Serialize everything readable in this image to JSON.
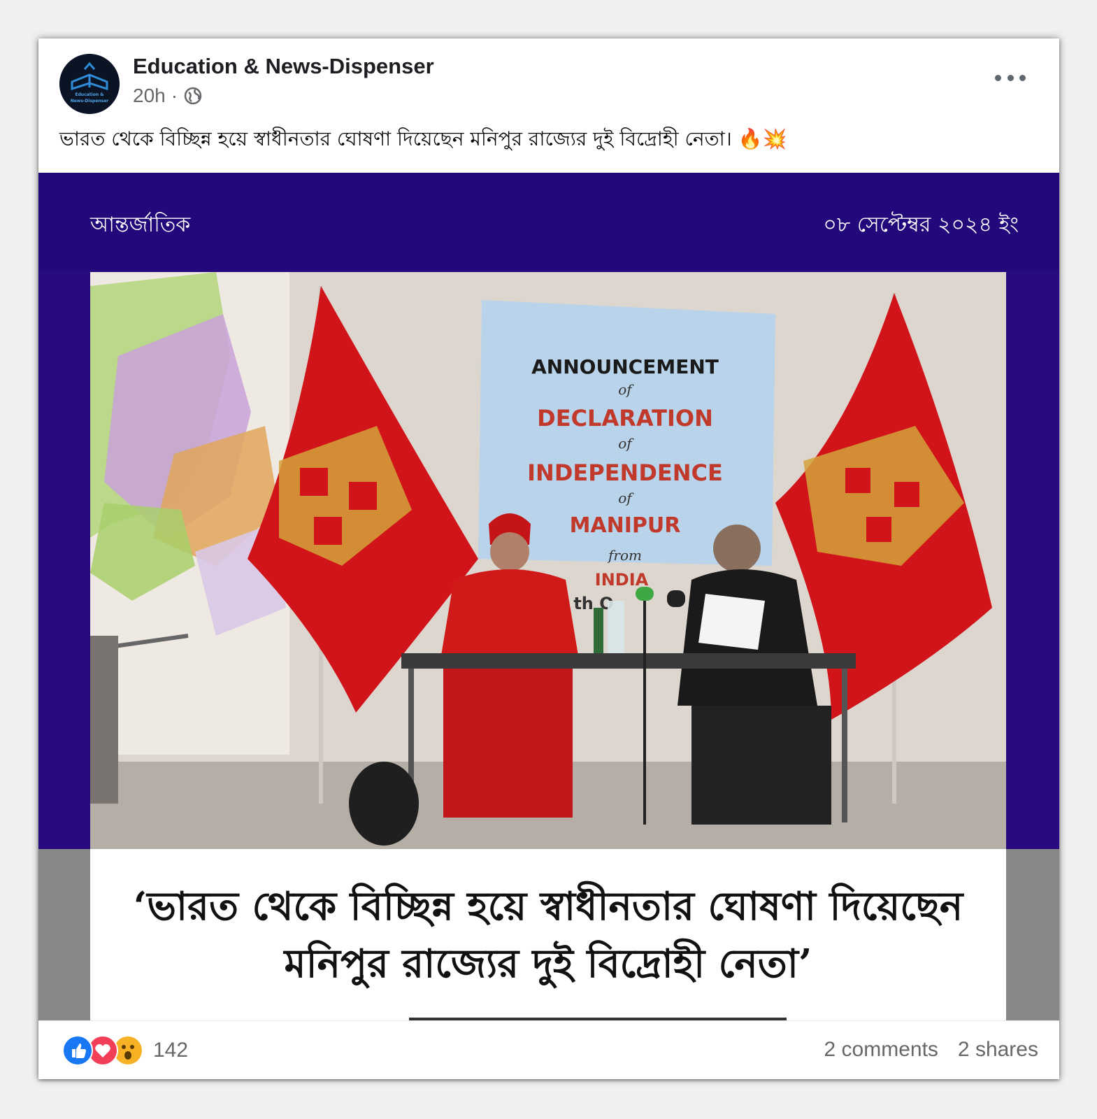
{
  "post": {
    "page_name": "Education & News-Dispenser",
    "time": "20h",
    "separator": "·",
    "audience_icon": "globe-icon",
    "avatar_text_1": "Education &",
    "avatar_text_2": "News-Dispenser",
    "caption": "ভারত থেকে বিচ্ছিন্ন হয়ে স্বাধীনতার ঘোষণা দিয়েছেন মনিপুর রাজ্যের দুই বিদ্রোহী নেতা।",
    "caption_emojis": "🔥💥"
  },
  "media": {
    "category": "আন্তর্জাতিক",
    "date": "০৮ সেপ্টেম্বর ২০২৪ ইং",
    "banner_lines": [
      "ANNOUNCEMENT",
      "of",
      "DECLARATION",
      "of",
      "INDEPENDENCE",
      "of",
      "MANIPUR",
      "from",
      "INDIA"
    ],
    "banner_partial": "th O",
    "headline_line1": "‘ভারত থেকে বিচ্ছিন্ন হয়ে স্বাধীনতার ঘোষণা দিয়েছেন",
    "headline_line2": "মনিপুর রাজ্যের দুই বিদ্রোহী নেতা’",
    "colors": {
      "background": "#2a0a80",
      "flag_red": "#d1141a",
      "flag_gold": "#d4a23a",
      "banner": "#b9d4ea",
      "banner_red_text": "#c0392b"
    }
  },
  "footer": {
    "reactions_count": "142",
    "reaction_icons": [
      "like-icon",
      "love-icon",
      "wow-icon"
    ],
    "comments": "2 comments",
    "shares": "2 shares"
  }
}
